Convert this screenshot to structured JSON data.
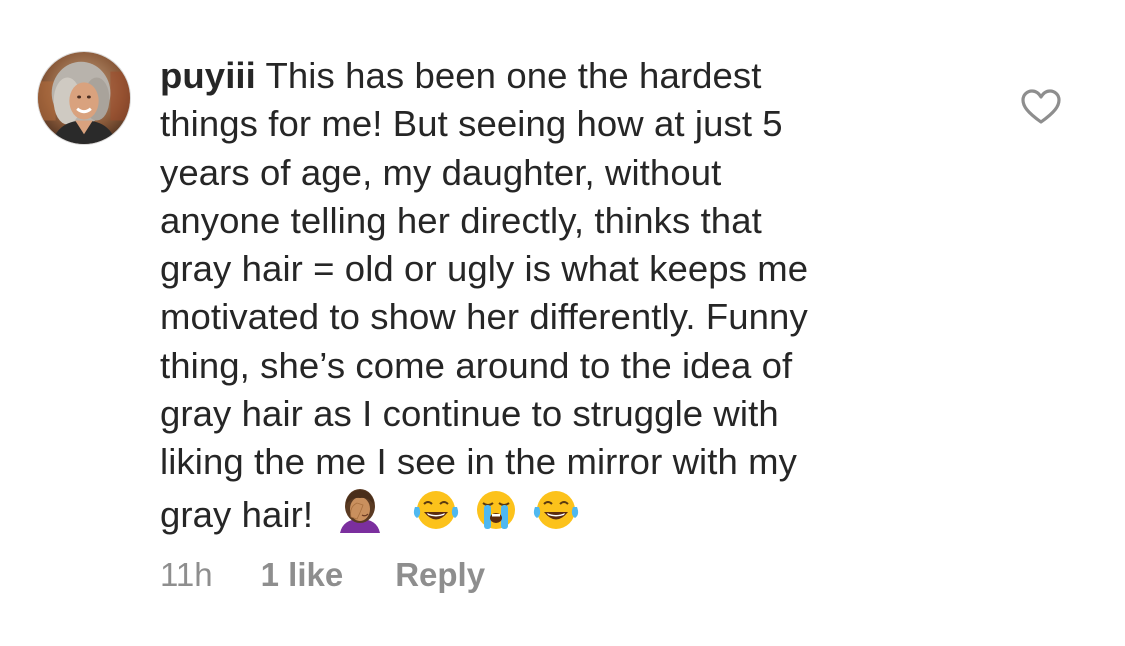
{
  "comment": {
    "username": "puyiii",
    "lines": [
      " This has been one the hardest",
      "things for me! But seeing how at just 5",
      "years of age, my daughter, without",
      "anyone telling her directly, thinks that",
      "gray hair = old or ugly is what keeps me",
      "motivated to show her differently. Funny",
      "thing, she’s come around to the idea of",
      "gray hair as I continue to struggle with",
      "liking the me I see in the mirror with my",
      "gray hair!"
    ],
    "emojis": [
      "woman-facepalming-emoji",
      "tears-of-joy-emoji",
      "loudly-crying-emoji",
      "tears-of-joy-emoji"
    ],
    "time": "11h",
    "likes": "1 like",
    "reply": "Reply"
  },
  "icons": {
    "like": "heart-outline-icon"
  },
  "colors": {
    "text": "#262626",
    "meta": "#8e8e8e",
    "heart": "#8e8e8e"
  }
}
